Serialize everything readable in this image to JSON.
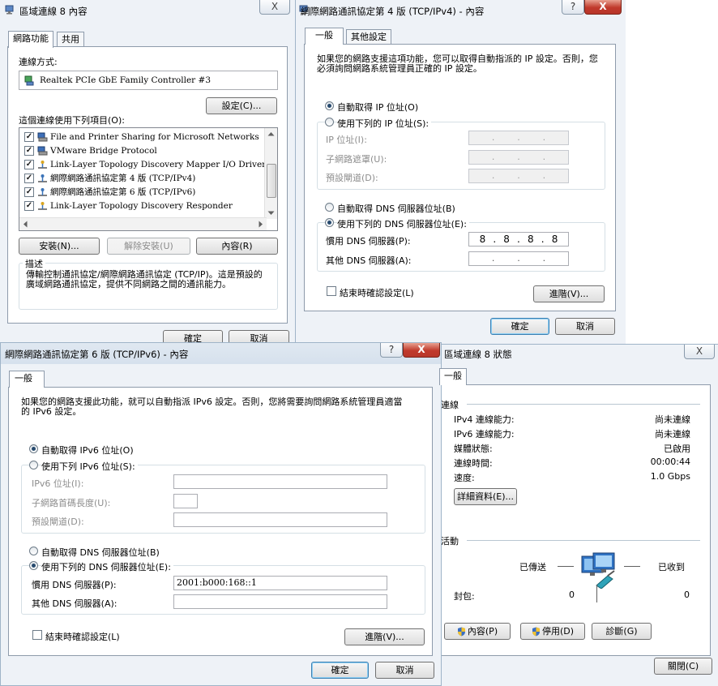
{
  "win1": {
    "title": "區域連線 8 內容",
    "close_glyph": "X",
    "tabs": [
      "網路功能",
      "共用"
    ],
    "connect_using_label": "連線方式:",
    "adapter": "Realtek PCIe GbE Family Controller #3",
    "configure_button": "設定(C)...",
    "items_label": "這個連線使用下列項目(O):",
    "items": [
      {
        "label": "File and Printer Sharing for Microsoft Networks",
        "icon": "network-service-icon"
      },
      {
        "label": "VMware Bridge Protocol",
        "icon": "network-service-icon"
      },
      {
        "label": "Link-Layer Topology Discovery Mapper I/O Driver",
        "icon": "protocol-icon"
      },
      {
        "label": "網際網路通訊協定第 4 版 (TCP/IPv4)",
        "icon": "protocol-icon"
      },
      {
        "label": "網際網路通訊協定第 6 版 (TCP/IPv6)",
        "icon": "protocol-icon"
      },
      {
        "label": "Link-Layer Topology Discovery Responder",
        "icon": "protocol-icon"
      }
    ],
    "check_glyph": "✓",
    "install_button": "安裝(N)...",
    "uninstall_button": "解除安裝(U)",
    "properties_button": "內容(R)",
    "description_label": "描述",
    "description_text": "傳輸控制通訊協定/網際網路通訊協定 (TCP/IP)。這是預設的廣域網路通訊協定，提供不同網路之間的通訊能力。",
    "ok_button": "確定",
    "cancel_button": "取消"
  },
  "win2": {
    "title": "網際網路通訊協定第 4 版 (TCP/IPv4) - 內容",
    "help_glyph": "?",
    "close_glyph": "X",
    "tabs": [
      "一般",
      "其他設定"
    ],
    "intro": "如果您的網路支援這項功能，您可以取得自動指派的 IP 設定。否則，您必須詢問網路系統管理員正確的 IP 設定。",
    "auto_ip": "自動取得 IP 位址(O)",
    "manual_ip": "使用下列的 IP 位址(S):",
    "ip_label": "IP 位址(I):",
    "mask_label": "子網路遮罩(U):",
    "gateway_label": "預設閘道(D):",
    "dots": [
      ".",
      ".",
      "."
    ],
    "auto_dns": "自動取得 DNS 伺服器位址(B)",
    "manual_dns": "使用下列的 DNS 伺服器位址(E):",
    "preferred_dns_label": "慣用 DNS 伺服器(P):",
    "preferred_dns": [
      "8",
      ".",
      "8",
      ".",
      "8",
      ".",
      "8"
    ],
    "alternate_dns_label": "其他 DNS 伺服器(A):",
    "validate_label": "結束時確認設定(L)",
    "advanced_button": "進階(V)...",
    "ok_button": "確定",
    "cancel_button": "取消"
  },
  "win3": {
    "title": "網際網路通訊協定第 6 版 (TCP/IPv6) - 內容",
    "help_glyph": "?",
    "close_glyph": "X",
    "tab": "一般",
    "intro": "如果您的網路支援此功能，就可以自動指派 IPv6 設定。否則，您將需要詢問網路系統管理員適當的 IPv6 設定。",
    "auto_ip": "自動取得 IPv6 位址(O)",
    "manual_ip": "使用下列 IPv6 位址(S):",
    "ip_label": "IPv6 位址(I):",
    "prefix_label": "子網路首碼長度(U):",
    "gateway_label": "預設閘道(D):",
    "auto_dns": "自動取得 DNS 伺服器位址(B)",
    "manual_dns": "使用下列的 DNS 伺服器位址(E):",
    "preferred_dns_label": "慣用 DNS 伺服器(P):",
    "preferred_dns": "2001:b000:168::1",
    "alternate_dns_label": "其他 DNS 伺服器(A):",
    "validate_label": "結束時確認設定(L)",
    "advanced_button": "進階(V)...",
    "ok_button": "確定",
    "cancel_button": "取消"
  },
  "win4": {
    "title": "區域連線 8 狀態",
    "close_glyph": "X",
    "tab": "一般",
    "connection_header": "連線",
    "rows": [
      {
        "label": "IPv4 連線能力:",
        "value": "尚未連線"
      },
      {
        "label": "IPv6 連線能力:",
        "value": "尚未連線"
      },
      {
        "label": "媒體狀態:",
        "value": "已啟用"
      },
      {
        "label": "連線時間:",
        "value": "00:00:44"
      },
      {
        "label": "速度:",
        "value": "1.0 Gbps"
      }
    ],
    "details_button": "詳細資料(E)...",
    "activity_header": "活動",
    "sent_label": "已傳送",
    "received_label": "已收到",
    "packets_label": "封包:",
    "packets_sent": "0",
    "packets_received": "0",
    "properties_button": "內容(P)",
    "disable_button": "停用(D)",
    "diagnose_button": "診斷(G)",
    "close_button": "關閉(C)"
  }
}
